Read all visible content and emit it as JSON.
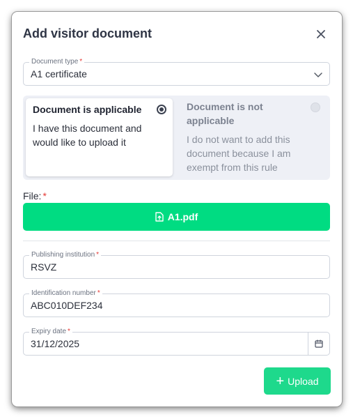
{
  "dialog": {
    "title": "Add visitor document",
    "close_icon": "close-icon"
  },
  "document_type": {
    "label": "Document type",
    "required_mark": "*",
    "value": "A1 certificate",
    "icon": "chevron-down-icon"
  },
  "applicability": {
    "options": [
      {
        "title": "Document is applicable",
        "description": "I have this document and would like to upload it",
        "selected": true
      },
      {
        "title": "Document is not applicable",
        "description": "I do not want to add this document because I am exempt from this rule",
        "selected": false
      }
    ]
  },
  "file": {
    "label": "File:",
    "required_mark": "*",
    "filename": "A1.pdf",
    "icon": "file-upload-icon",
    "button_color": "#00dc82"
  },
  "publishing_institution": {
    "label": "Publishing institution",
    "required_mark": "*",
    "value": "RSVZ"
  },
  "identification_number": {
    "label": "Identification number",
    "required_mark": "*",
    "value": "ABC010DEF234"
  },
  "expiry_date": {
    "label": "Expiry date",
    "required_mark": "*",
    "value": "31/12/2025",
    "icon": "calendar-icon"
  },
  "upload_button": {
    "label": "Upload",
    "icon": "plus-icon",
    "color": "#1ed98c"
  }
}
